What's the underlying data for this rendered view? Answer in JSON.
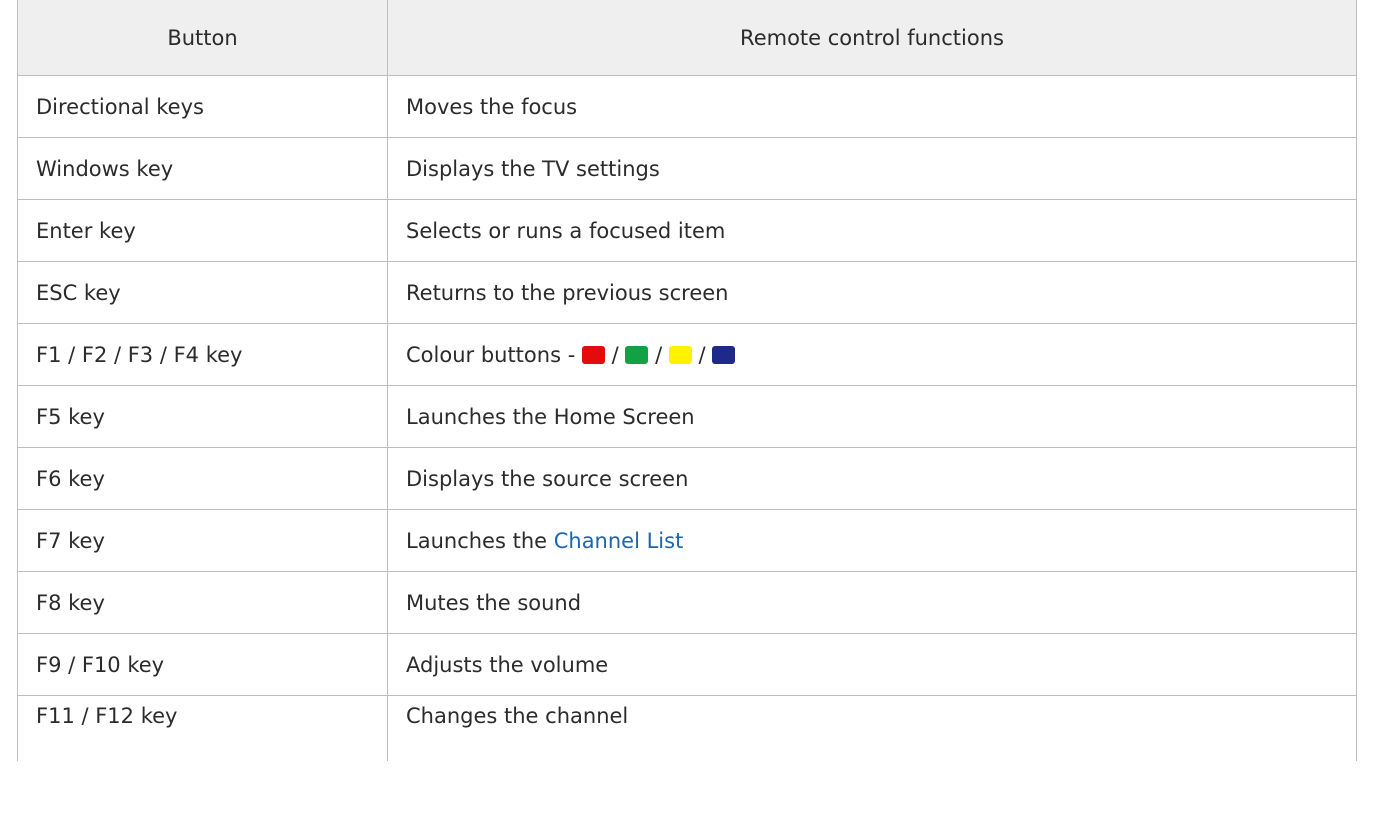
{
  "header": {
    "col_button": "Button",
    "col_function": "Remote control functions"
  },
  "rows": [
    {
      "button": "Directional keys",
      "function": "Moves the focus"
    },
    {
      "button": "Windows key",
      "function": "Displays the TV settings"
    },
    {
      "button": "Enter key",
      "function": "Selects or runs a focused item"
    },
    {
      "button": "ESC key",
      "function": "Returns to the previous screen"
    },
    {
      "button": "F1 / F2 / F3 / F4 key",
      "function_prefix": "Colour buttons - ",
      "separator": " / ",
      "colors": {
        "red": "#e30b0b",
        "green": "#14a045",
        "yellow": "#fff200",
        "blue": "#1d2a8c"
      }
    },
    {
      "button": "F5 key",
      "function": "Launches the Home Screen"
    },
    {
      "button": "F6 key",
      "function": "Displays the source screen"
    },
    {
      "button": "F7 key",
      "function_prefix": "Launches the ",
      "function_link": "Channel List"
    },
    {
      "button": "F8 key",
      "function": "Mutes the sound"
    },
    {
      "button": "F9 / F10 key",
      "function": "Adjusts the volume"
    },
    {
      "button": "F11 / F12 key",
      "function": "Changes the channel"
    }
  ]
}
